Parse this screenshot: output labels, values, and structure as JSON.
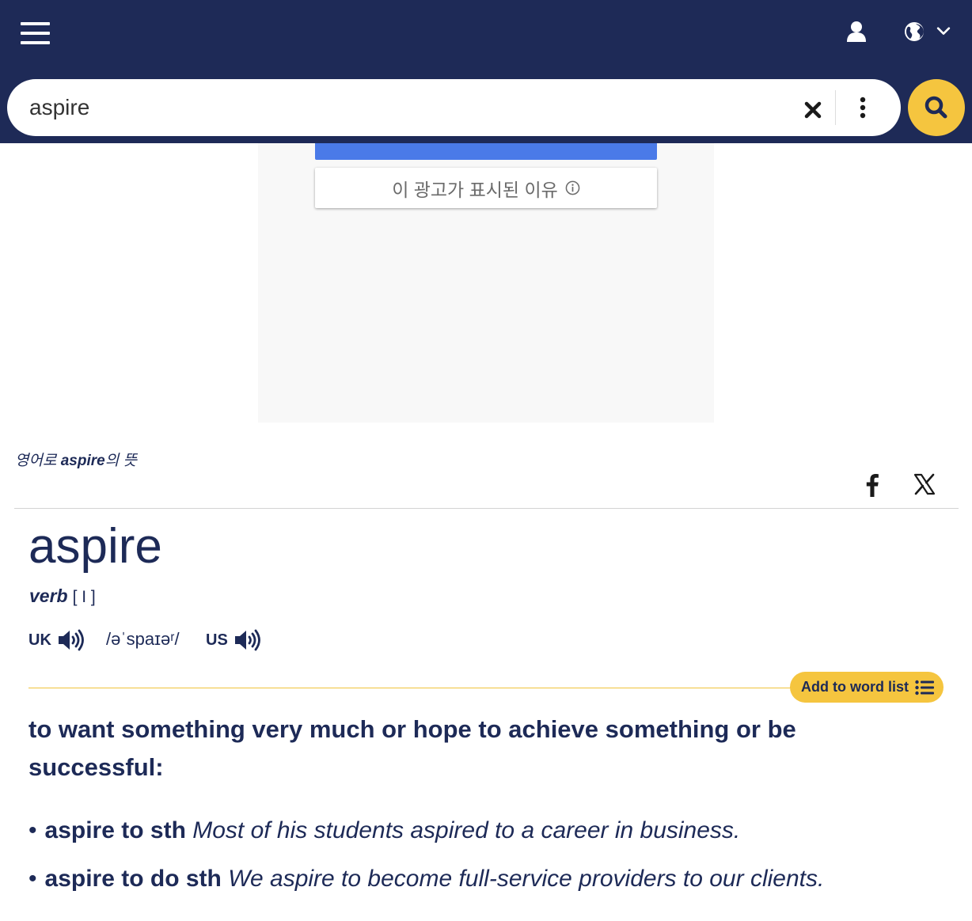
{
  "header": {
    "menu_icon": "hamburger-menu-icon",
    "user_icon": "user-icon",
    "language_icon": "globe-icon"
  },
  "search": {
    "value": "aspire",
    "placeholder": "",
    "clear_icon": "close-icon",
    "more_icon": "vertical-dots-icon",
    "submit_icon": "search-icon"
  },
  "ad": {
    "why_label": "이 광고가 표시된 이유"
  },
  "entry": {
    "meaning_prefix": "영어로 ",
    "meaning_word": "aspire",
    "meaning_suffix": "의 뜻",
    "headword": "aspire",
    "pos": "verb",
    "grammar": "[ I ]",
    "uk_label": "UK",
    "ipa": "/əˈspaɪəʳ/",
    "us_label": "US",
    "add_to_word_list": "Add to word list",
    "definition": "to want something very much or hope to achieve something or be successful:",
    "examples": [
      {
        "phrase": "aspire to sth",
        "sentence": "Most of his students aspired to a career in business."
      },
      {
        "phrase": "aspire to do sth",
        "sentence": "We aspire to become full-service providers to our clients."
      }
    ]
  },
  "share": {
    "facebook_icon": "facebook-icon",
    "x_icon": "x-twitter-icon"
  },
  "colors": {
    "nav_bg": "#1e2a57",
    "accent_yellow": "#f5c53f",
    "text_navy": "#1d2a57",
    "ad_blue": "#4a7ae8"
  }
}
